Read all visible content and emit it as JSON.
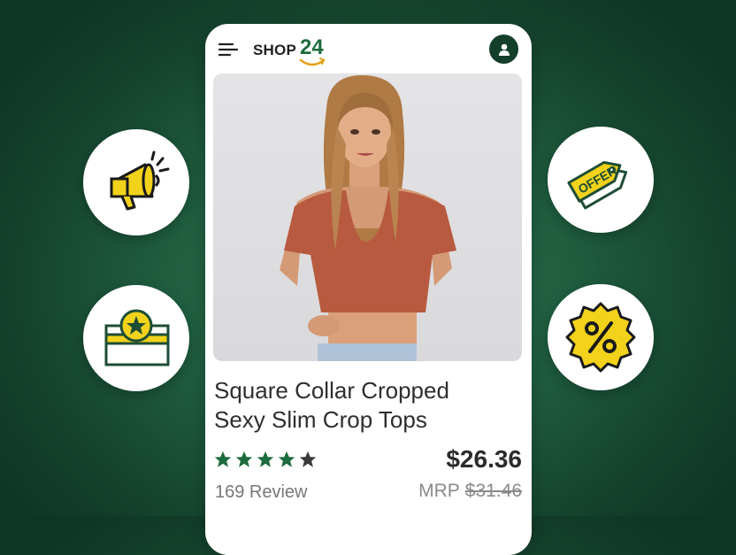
{
  "brand": {
    "name": "SHOP",
    "number": "24"
  },
  "product": {
    "title_line1": "Square Collar Cropped",
    "title_line2": "Sexy Slim Crop Tops",
    "price": "$26.36",
    "mrp_label": "MRP",
    "mrp_value": "$31.46",
    "reviews": "169 Review",
    "rating": 4,
    "rating_max": 5
  },
  "feature_icons": [
    "megaphone-icon",
    "reward-card-icon",
    "offer-tag-icon",
    "percent-badge-icon"
  ],
  "colors": {
    "background": "#1f5d3f",
    "accent_yellow": "#f2d21b",
    "accent_green": "#1d6b3e",
    "star_filled": "#1d6b3e",
    "star_empty": "#3a3a3a"
  }
}
